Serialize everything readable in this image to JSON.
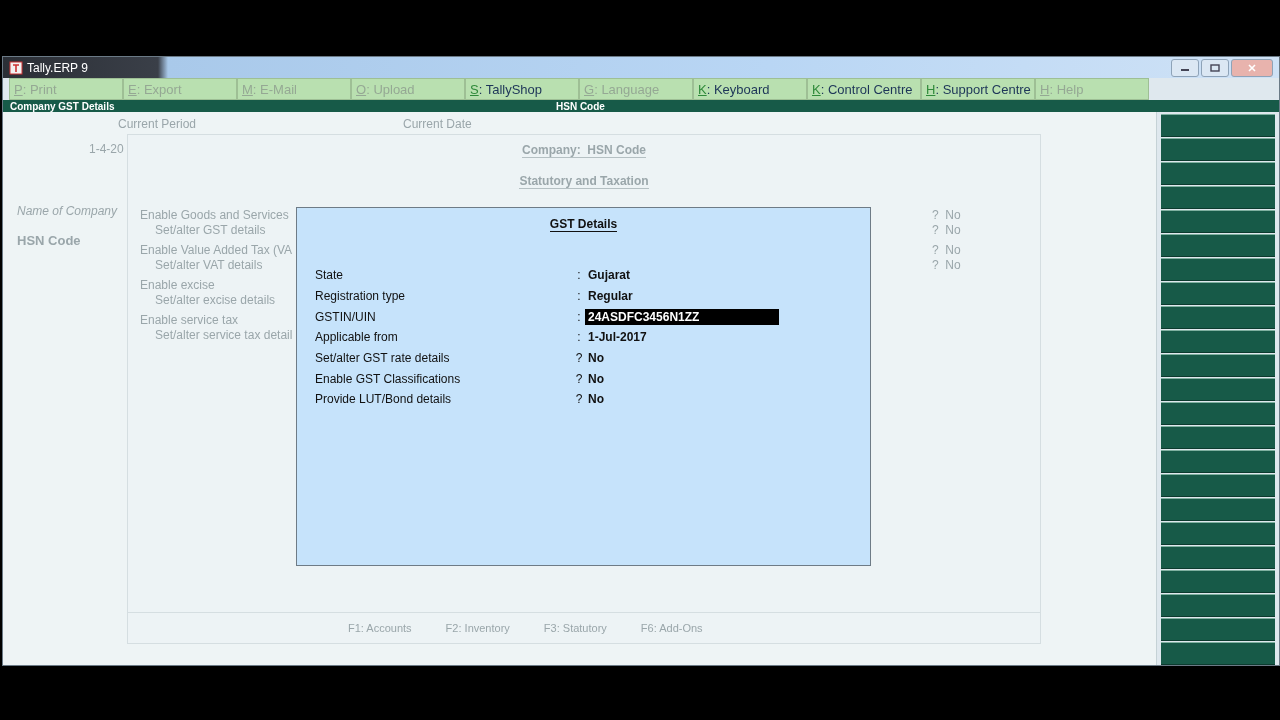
{
  "window": {
    "title": "Tally.ERP 9"
  },
  "button_bar": [
    {
      "key": "P",
      "sep": ":",
      "label": "Print",
      "disabled": true
    },
    {
      "key": "E",
      "sep": ":",
      "label": "Export",
      "disabled": true
    },
    {
      "key": "M",
      "sep": ":",
      "label": "E-Mail",
      "disabled": true
    },
    {
      "key": "O",
      "sep": ":",
      "label": "Upload",
      "disabled": true
    },
    {
      "key": "S",
      "sep": ":",
      "label": "TallyShop",
      "disabled": false
    },
    {
      "key": "G",
      "sep": ":",
      "label": "Language",
      "disabled": true
    },
    {
      "key": "K",
      "sep": ":",
      "label": "Keyboard",
      "disabled": false
    },
    {
      "key": "K",
      "sep": ":",
      "label": "Control Centre",
      "disabled": false
    },
    {
      "key": "H",
      "sep": ":",
      "label": "Support Centre",
      "disabled": false
    },
    {
      "key": "H",
      "sep": ":",
      "label": "Help",
      "disabled": true
    }
  ],
  "header": {
    "left": "Company GST Details",
    "center": "HSN Code"
  },
  "background": {
    "current_period_label": "Current Period",
    "current_period": "1-4-20",
    "current_date_label": "Current Date",
    "name_label": "Name of Company",
    "company_name": "HSN Code"
  },
  "sub_screen": {
    "company_label": "Company:",
    "company_name": "HSN Code",
    "section_title": "Statutory and Taxation",
    "options": [
      {
        "label": "Enable Goods and Services",
        "separator": "?",
        "value": "No",
        "children": [
          {
            "label": "Set/alter GST details",
            "separator": "?",
            "value": "No"
          }
        ]
      },
      {
        "label": "Enable Value Added Tax (VA",
        "separator": "?",
        "value": "No",
        "children": [
          {
            "label": "Set/alter VAT details",
            "separator": "?",
            "value": "No"
          }
        ]
      },
      {
        "label": "Enable excise",
        "children": [
          {
            "label": "Set/alter excise details"
          }
        ]
      },
      {
        "label": "Enable service tax",
        "children": [
          {
            "label": "Set/alter service tax detail"
          }
        ]
      }
    ],
    "footer": [
      {
        "key": "F1:",
        "label": "Accounts"
      },
      {
        "key": "F2:",
        "label": "Inventory"
      },
      {
        "key": "F3:",
        "label": "Statutory"
      },
      {
        "key": "F6:",
        "label": "Add-Ons"
      }
    ]
  },
  "dialog": {
    "title": "GST Details",
    "fields": [
      {
        "label": "State",
        "separator": ":",
        "value": "Gujarat",
        "selected": false
      },
      {
        "label": "Registration type",
        "separator": ":",
        "value": "Regular",
        "selected": false
      },
      {
        "label": "GSTIN/UIN",
        "separator": ":",
        "value": "24ASDFC3456N1ZZ",
        "selected": true
      },
      {
        "label": "Applicable from",
        "separator": ":",
        "value": "1-Jul-2017",
        "selected": false
      },
      {
        "label": "Set/alter GST rate details",
        "separator": "?",
        "value": "No",
        "selected": false
      },
      {
        "label": "Enable GST Classifications",
        "separator": "?",
        "value": "No",
        "selected": false
      },
      {
        "label": "Provide LUT/Bond details",
        "separator": "?",
        "value": "No",
        "selected": false
      }
    ]
  }
}
